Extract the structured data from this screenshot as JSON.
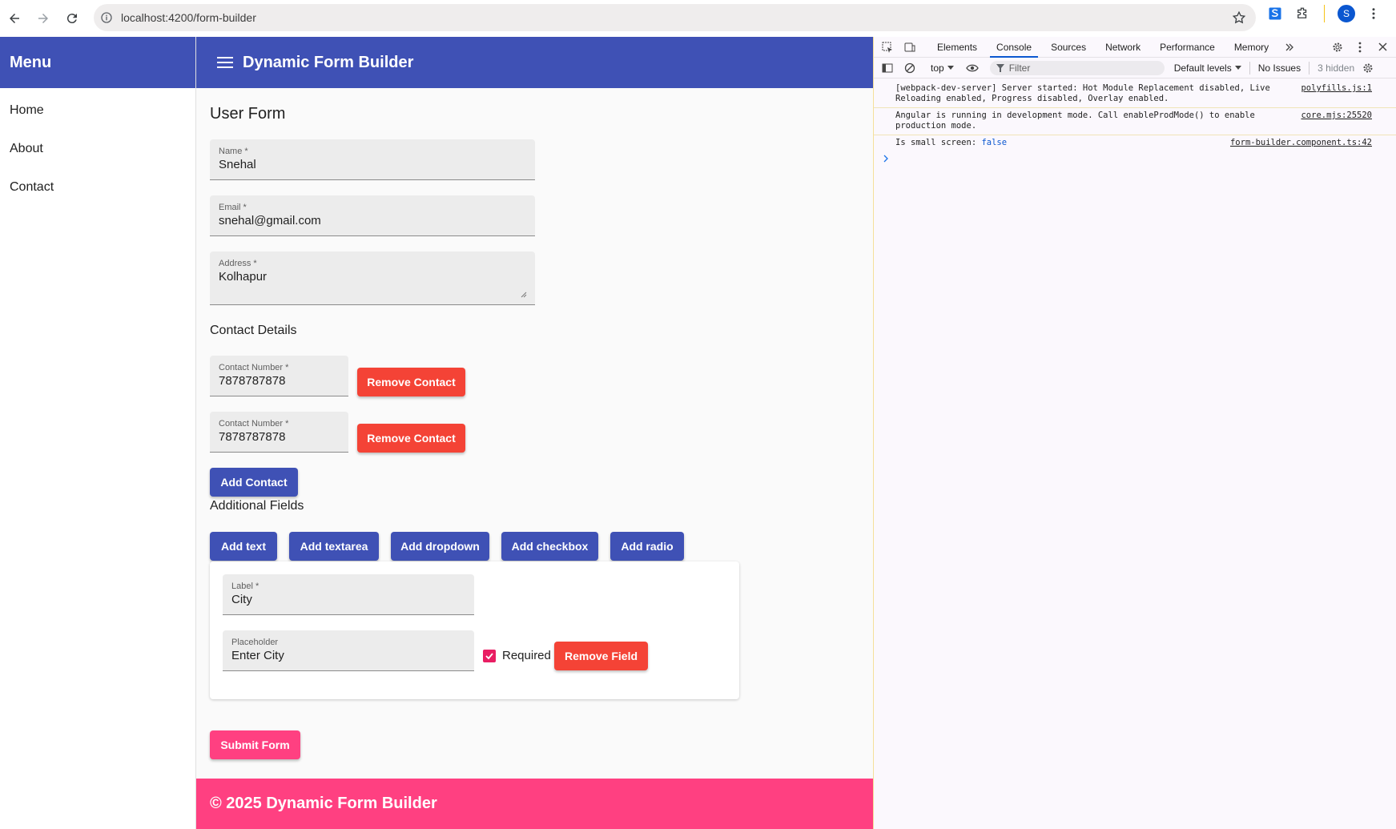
{
  "browser": {
    "url": "localhost:4200/form-builder",
    "profile_initial": "S"
  },
  "sidenav": {
    "header": "Menu",
    "items": [
      {
        "label": "Home"
      },
      {
        "label": "About"
      },
      {
        "label": "Contact"
      }
    ]
  },
  "toolbar": {
    "title": "Dynamic Form Builder"
  },
  "form": {
    "title": "User Form",
    "name": {
      "label": "Name *",
      "value": "Snehal"
    },
    "email": {
      "label": "Email *",
      "value": "snehal@gmail.com"
    },
    "address": {
      "label": "Address *",
      "value": "Kolhapur"
    },
    "contact_section_title": "Contact Details",
    "contacts": [
      {
        "label": "Contact Number *",
        "value": "7878787878",
        "remove_label": "Remove Contact"
      },
      {
        "label": "Contact Number *",
        "value": "7878787878",
        "remove_label": "Remove Contact"
      }
    ],
    "add_contact_label": "Add Contact",
    "additional_section_title": "Additional Fields",
    "add_buttons": [
      "Add text",
      "Add textarea",
      "Add dropdown",
      "Add checkbox",
      "Add radio"
    ],
    "dynamic_field": {
      "label_field": {
        "label": "Label *",
        "value": "City"
      },
      "placeholder_field": {
        "label": "Placeholder",
        "value": "Enter City"
      },
      "required_label": "Required",
      "required_checked": true,
      "remove_label": "Remove Field"
    },
    "submit_label": "Submit Form"
  },
  "footer": {
    "text": "© 2025 Dynamic Form Builder"
  },
  "devtools": {
    "tabs": [
      "Elements",
      "Console",
      "Sources",
      "Network",
      "Performance",
      "Memory"
    ],
    "active_tab": "Console",
    "context": "top",
    "filter_placeholder": "Filter",
    "levels": "Default levels",
    "issues": "No Issues",
    "hidden": "3 hidden",
    "messages": [
      {
        "text": "[webpack-dev-server] Server started: Hot Module Replacement disabled, Live Reloading enabled, Progress disabled, Overlay enabled.",
        "source": "polyfills.js:1"
      },
      {
        "text": "Angular is running in development mode. Call enableProdMode() to enable production mode.",
        "source": "core.mjs:25520"
      },
      {
        "text": "Is small screen: ",
        "value": "false",
        "source": "form-builder.component.ts:42"
      }
    ]
  },
  "colors": {
    "primary": "#3f51b5",
    "accent": "#ff4081",
    "warn": "#f44336"
  }
}
